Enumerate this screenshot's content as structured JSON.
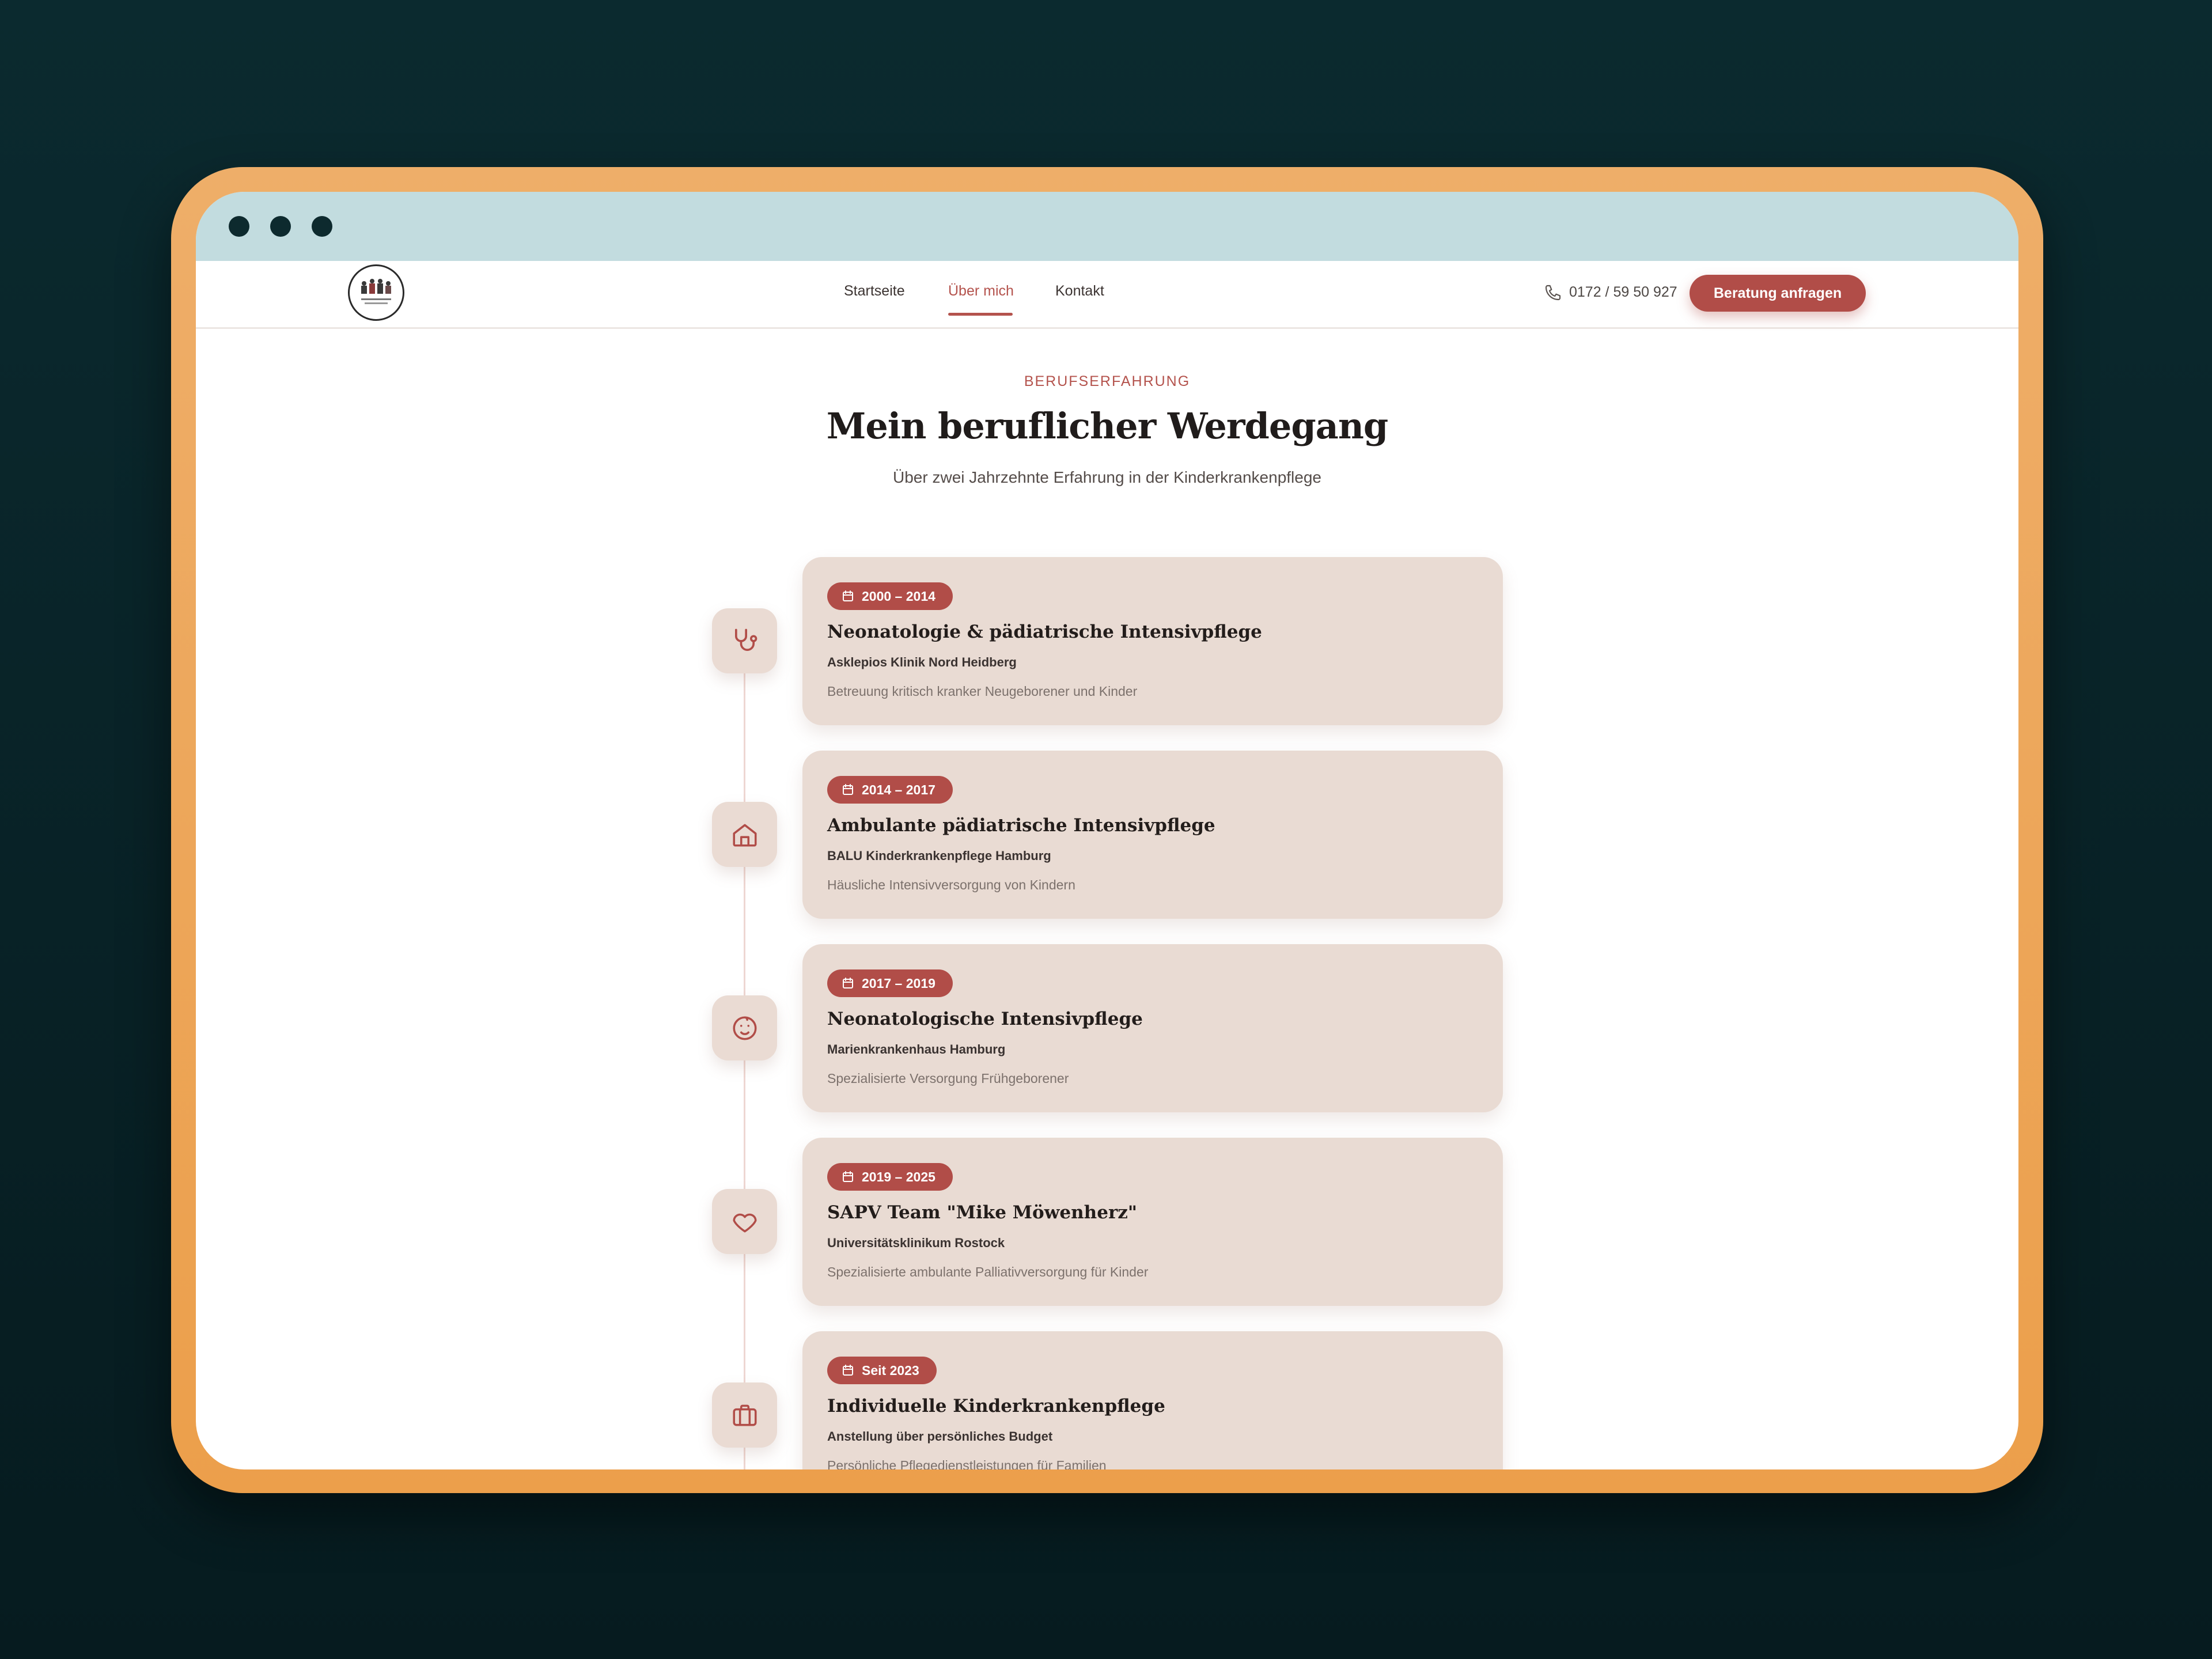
{
  "nav": {
    "links": [
      "Startseite",
      "Über mich",
      "Kontakt"
    ],
    "active": "Über mich",
    "phone": "0172 / 59 50 927",
    "cta_label": "Beratung anfragen"
  },
  "section": {
    "eyebrow": "BERUFSERFAHRUNG",
    "title": "Mein beruflicher Werdegang",
    "subtitle": "Über zwei Jahrzehnte Erfahrung in der Kinderkrankenpflege"
  },
  "timeline": [
    {
      "period": "2000 – 2014",
      "title": "Neonatologie & pädiatrische Intensivpflege",
      "org": "Asklepios Klinik Nord Heidberg",
      "desc": "Betreuung kritisch kranker Neugeborener und Kinder",
      "icon": "stethoscope-icon"
    },
    {
      "period": "2014 – 2017",
      "title": "Ambulante pädiatrische Intensivpflege",
      "org": "BALU Kinderkrankenpflege Hamburg",
      "desc": "Häusliche Intensivversorgung von Kindern",
      "icon": "home-icon"
    },
    {
      "period": "2017 – 2019",
      "title": "Neonatologische Intensivpflege",
      "org": "Marienkrankenhaus Hamburg",
      "desc": "Spezialisierte Versorgung Frühgeborener",
      "icon": "baby-icon"
    },
    {
      "period": "2019 – 2025",
      "title": "SAPV Team \"Mike Möwenherz\"",
      "org": "Universitätsklinikum Rostock",
      "desc": "Spezialisierte ambulante Palliativversorgung für Kinder",
      "icon": "heart-icon"
    },
    {
      "period": "Seit 2023",
      "title": "Individuelle Kinderkrankenpflege",
      "org": "Anstellung über persönliches Budget",
      "desc": "Persönliche Pflegedienstleistungen für Familien",
      "icon": "briefcase-icon"
    }
  ],
  "colors": {
    "accent": "#b14d48",
    "card": "#e9dbd3",
    "titlebar": "#c2dcdf",
    "frame": "#ec9f4b",
    "background": "#0b2a2f"
  }
}
